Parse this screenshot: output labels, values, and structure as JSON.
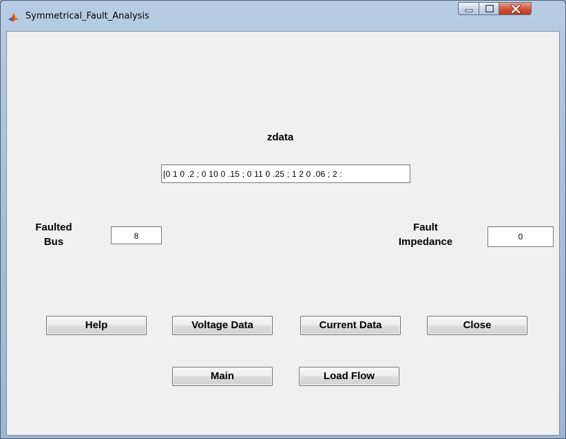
{
  "window": {
    "title": "Symmetrical_Fault_Analysis",
    "icon": "matlab-logo-icon",
    "controls": [
      "minimize-icon",
      "maximize-icon",
      "close-icon"
    ]
  },
  "form": {
    "zdata_label": "zdata",
    "zdata_value": "[0 1 0 .2 ; 0 10 0 .15 ; 0 11 0 .25 ; 1 2 0 .06 ; 2 :",
    "faulted_bus_label_line1": "Faulted",
    "faulted_bus_label_line2": "Bus",
    "faulted_bus_value": "8",
    "fault_impedance_label_line1": "Fault",
    "fault_impedance_label_line2": "Impedance",
    "fault_impedance_value": "0"
  },
  "buttons": {
    "help": "Help",
    "voltage_data": "Voltage Data",
    "current_data": "Current Data",
    "close": "Close",
    "main": "Main",
    "load_flow": "Load Flow"
  }
}
